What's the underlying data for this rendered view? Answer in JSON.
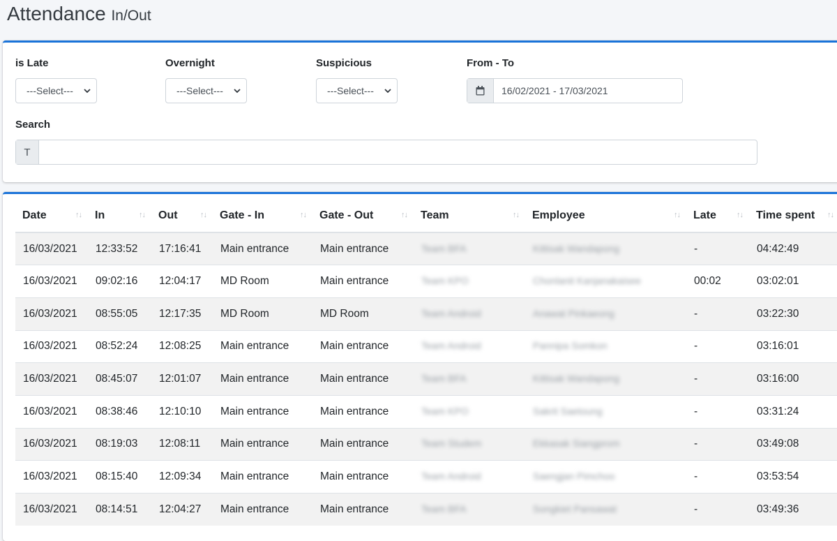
{
  "header": {
    "title": "Attendance",
    "subtitle": "In/Out"
  },
  "filters": {
    "is_late": {
      "label": "is Late",
      "value": "---Select---"
    },
    "overnight": {
      "label": "Overnight",
      "value": "---Select---"
    },
    "suspicious": {
      "label": "Suspicious",
      "value": "---Select---"
    },
    "date_range": {
      "label": "From - To",
      "value": "16/02/2021 - 17/03/2021",
      "icon": "calendar-icon"
    },
    "search": {
      "label": "Search",
      "addon": "T",
      "value": "",
      "placeholder": ""
    }
  },
  "table": {
    "columns": [
      "Date",
      "In",
      "Out",
      "Gate - In",
      "Gate - Out",
      "Team",
      "Employee",
      "Late",
      "Time spent"
    ],
    "rows": [
      [
        "16/03/2021",
        "12:33:52",
        "17:16:41",
        "Main entrance",
        "Main entrance",
        "Team BFA",
        "Kittisak Wandapong",
        "-",
        "04:42:49"
      ],
      [
        "16/03/2021",
        "09:02:16",
        "12:04:17",
        "MD Room",
        "Main entrance",
        "Team KPO",
        "Chonlanit Kanjanakaisee",
        "00:02",
        "03:02:01"
      ],
      [
        "16/03/2021",
        "08:55:05",
        "12:17:35",
        "MD Room",
        "MD Room",
        "Team Android",
        "Anawat Pinkaeong",
        "-",
        "03:22:30"
      ],
      [
        "16/03/2021",
        "08:52:24",
        "12:08:25",
        "Main entrance",
        "Main entrance",
        "Team Android",
        "Pannipa Somkon",
        "-",
        "03:16:01"
      ],
      [
        "16/03/2021",
        "08:45:07",
        "12:01:07",
        "Main entrance",
        "Main entrance",
        "Team BFA",
        "Kittisak Wandapong",
        "-",
        "03:16:00"
      ],
      [
        "16/03/2021",
        "08:38:46",
        "12:10:10",
        "Main entrance",
        "Main entrance",
        "Team KPO",
        "Sakrit Saetoung",
        "-",
        "03:31:24"
      ],
      [
        "16/03/2021",
        "08:19:03",
        "12:08:11",
        "Main entrance",
        "Main entrance",
        "Team Studem",
        "Ekkasak Siangprom",
        "-",
        "03:49:08"
      ],
      [
        "16/03/2021",
        "08:15:40",
        "12:09:34",
        "Main entrance",
        "Main entrance",
        "Team Android",
        "Saengjan Pimchoo",
        "-",
        "03:53:54"
      ],
      [
        "16/03/2021",
        "08:14:51",
        "12:04:27",
        "Main entrance",
        "Main entrance",
        "Team BFA",
        "Songkiet Pansawat",
        "-",
        "03:49:36"
      ]
    ]
  },
  "colors": {
    "accent": "#1a73d9",
    "stripe": "#f2f2f2",
    "border": "#dee2e6"
  }
}
